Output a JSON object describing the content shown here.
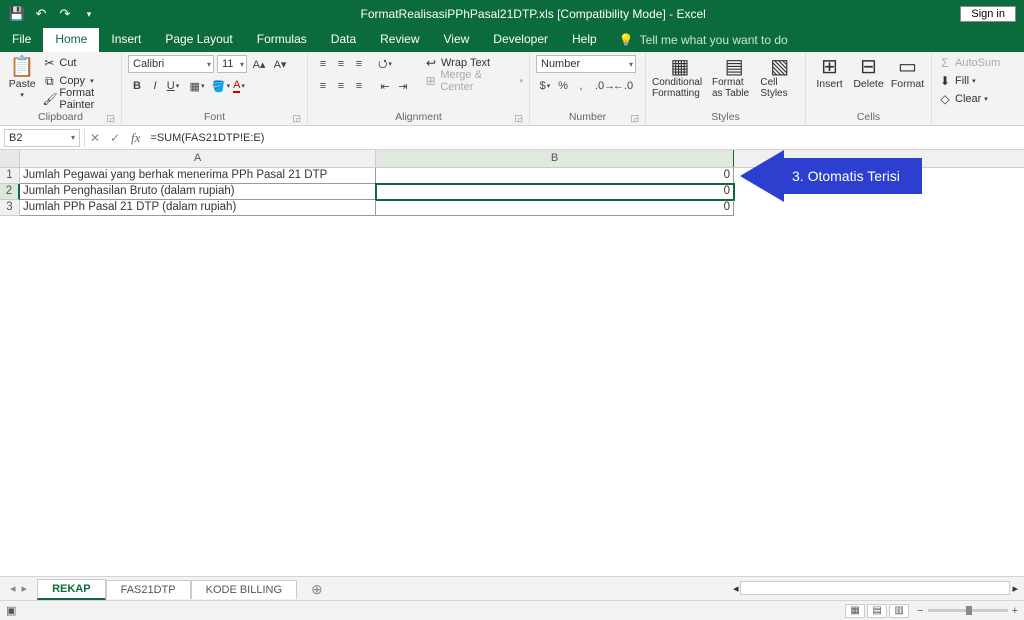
{
  "titlebar": {
    "doc_title": "FormatRealisasiPPhPasal21DTP.xls  [Compatibility Mode]  -  Excel",
    "signin": "Sign in"
  },
  "tabs": {
    "file": "File",
    "home": "Home",
    "insert": "Insert",
    "pagelayout": "Page Layout",
    "formulas": "Formulas",
    "data": "Data",
    "review": "Review",
    "view": "View",
    "developer": "Developer",
    "help": "Help",
    "tellme": "Tell me what you want to do"
  },
  "ribbon": {
    "clipboard": {
      "paste": "Paste",
      "cut": "Cut",
      "copy": "Copy",
      "painter": "Format Painter",
      "label": "Clipboard"
    },
    "font": {
      "name": "Calibri",
      "size": "11",
      "label": "Font"
    },
    "alignment": {
      "wrap": "Wrap Text",
      "merge": "Merge & Center",
      "label": "Alignment"
    },
    "number": {
      "format": "Number",
      "label": "Number"
    },
    "styles": {
      "cond": "Conditional Formatting",
      "table": "Format as Table",
      "cell": "Cell Styles",
      "label": "Styles"
    },
    "cells": {
      "insert": "Insert",
      "delete": "Delete",
      "format": "Format",
      "label": "Cells"
    },
    "editing": {
      "autosum": "AutoSum",
      "fill": "Fill",
      "clear": "Clear"
    }
  },
  "formula_bar": {
    "name": "B2",
    "formula": "=SUM(FAS21DTP!E:E)"
  },
  "columns": {
    "A": "A",
    "B": "B"
  },
  "rows": [
    {
      "n": "1",
      "a": "Jumlah Pegawai yang berhak menerima PPh Pasal 21 DTP",
      "b": "0"
    },
    {
      "n": "2",
      "a": "Jumlah Penghasilan Bruto (dalam rupiah)",
      "b": "0"
    },
    {
      "n": "3",
      "a": "Jumlah PPh Pasal 21 DTP (dalam rupiah)",
      "b": "0"
    }
  ],
  "callout": {
    "text": "3. Otomatis Terisi"
  },
  "sheets": {
    "s1": "REKAP",
    "s2": "FAS21DTP",
    "s3": "KODE BILLING"
  },
  "chart_data": null
}
